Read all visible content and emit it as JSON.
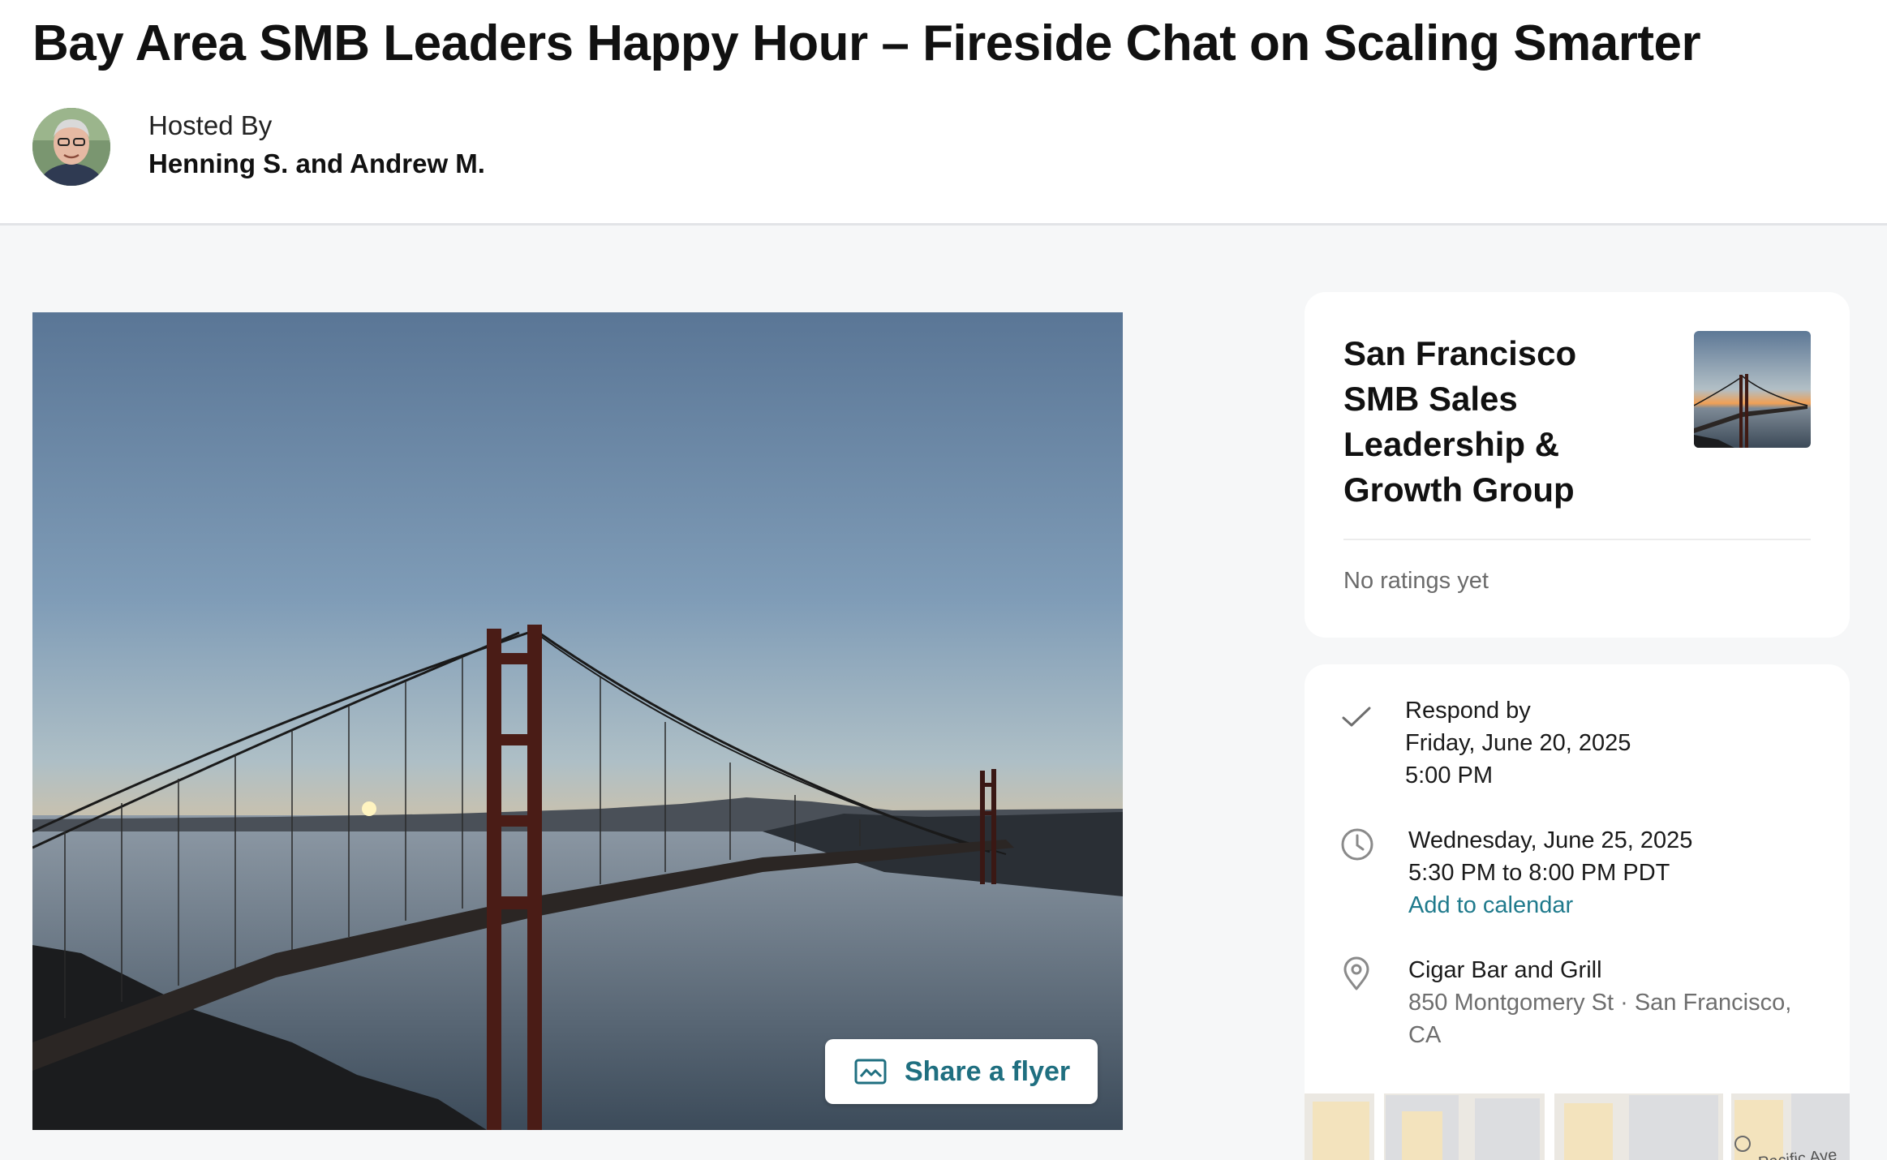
{
  "event": {
    "title": "Bay Area SMB Leaders Happy Hour – Fireside Chat on Scaling Smarter",
    "hosted_by_label": "Hosted By",
    "hosts": "Henning S. and Andrew M."
  },
  "hero": {
    "share_label": "Share a flyer",
    "icon": "image-icon"
  },
  "group": {
    "name": "San Francisco SMB Sales Leadership & Growth Group",
    "ratings": "No ratings yet"
  },
  "details": {
    "rsvp": {
      "icon": "check-icon",
      "label": "Respond by",
      "date": "Friday, June 20, 2025",
      "time": "5:00 PM"
    },
    "when": {
      "icon": "clock-icon",
      "date": "Wednesday, June 25, 2025",
      "time": "5:30 PM to 8:00 PM PDT",
      "calendar_link": "Add to calendar"
    },
    "where": {
      "icon": "location-pin-icon",
      "venue": "Cigar Bar and Grill",
      "address_line1": "850 Montgomery St · San Francisco,",
      "address_line2": "CA"
    },
    "map": {
      "street_label": "Pacific Ave"
    }
  },
  "colors": {
    "accent": "#1f7a8c",
    "background": "#f6f7f8",
    "card": "#ffffff"
  }
}
